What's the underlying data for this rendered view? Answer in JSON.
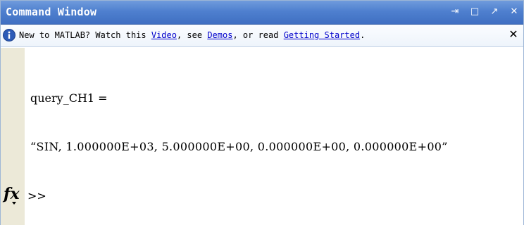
{
  "window": {
    "title": "Command Window",
    "controls": {
      "undock": "⇥",
      "maximize": "□",
      "restore": "↗",
      "close": "✕"
    }
  },
  "infobar": {
    "prefix": "New to MATLAB? Watch this ",
    "video_link": "Video",
    "sep1": ", see ",
    "demos_link": "Demos",
    "sep2": ", or read ",
    "getting_started_link": "Getting Started",
    "suffix": ".",
    "close_label": "✕"
  },
  "console": {
    "var_line": "query_CH1 =",
    "value_line": "“SIN, 1.000000E+03, 5.000000E+00, 0.000000E+00, 0.000000E+00”",
    "prompt_icon": "fx",
    "prompt": ">>"
  },
  "colors": {
    "titlebar": "#4f80cf",
    "gutter": "#ece9d8",
    "link": "#0000cc"
  }
}
